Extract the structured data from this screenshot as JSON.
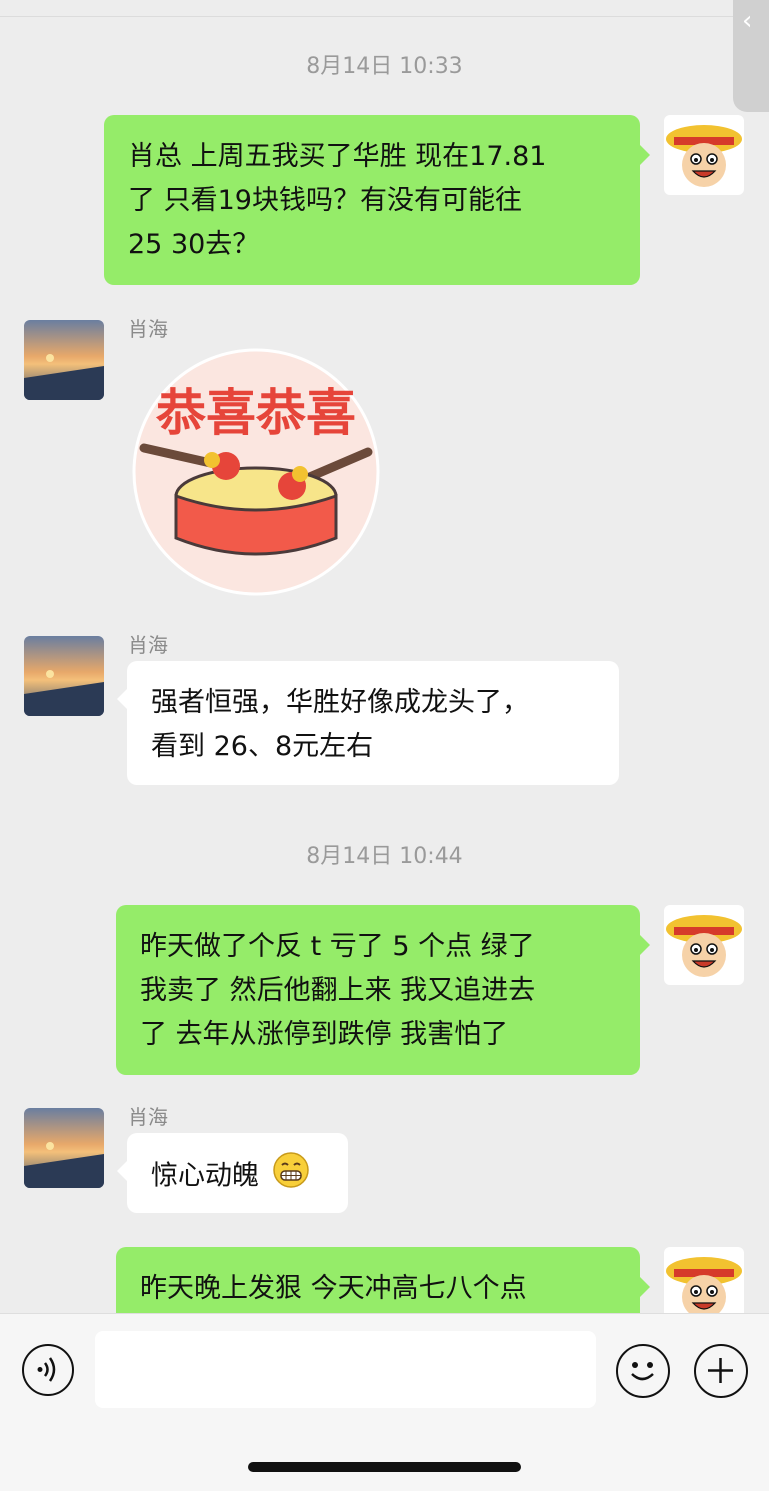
{
  "chat": {
    "ts1": "8月14日 10:33",
    "ts2": "8月14日 10:44",
    "contact_name": "肖海",
    "msg1_lines": [
      "肖总 上周五我买了华胜 现在17.81",
      "了  只看19块钱吗？有没有可能往",
      "25  30去？"
    ],
    "sticker_text": "恭喜恭喜",
    "msg3_lines": [
      "强者恒强，华胜好像成龙头了，",
      "看到 26、8元左右"
    ],
    "msg4_lines": [
      "昨天做了个反 t 亏了 5 个点  绿了",
      "我卖了 然后他翻上来 我又追进去",
      "了  去年从涨停到跌停 我害怕了"
    ],
    "msg5_text": "惊心动魄",
    "msg6_lines": [
      "昨天晚上发狠 今天冲高七八个点"
    ]
  },
  "icons": {
    "back": "chevron-left-icon",
    "voice": "voice-icon",
    "emoji": "emoji-icon",
    "plus": "plus-icon",
    "grin": "grin-emoji-icon"
  },
  "colors": {
    "background": "#ededed",
    "my_bubble": "#95ec69",
    "their_bubble": "#ffffff",
    "sticker_red": "#e6453a"
  }
}
